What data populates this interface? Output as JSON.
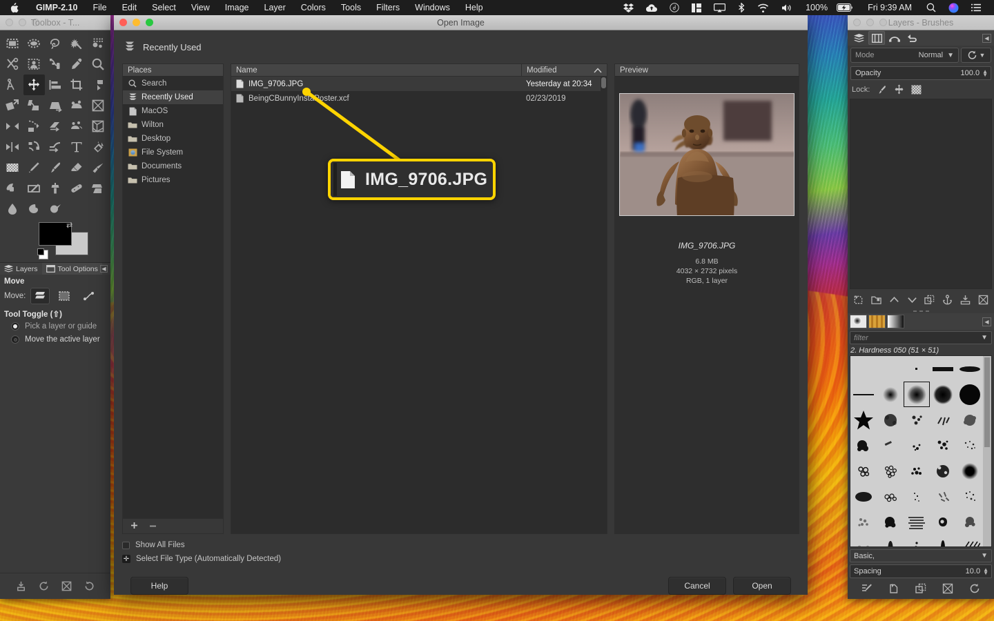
{
  "menubar": {
    "apple_icon": "apple-icon",
    "app_name": "GIMP-2.10",
    "items": [
      "File",
      "Edit",
      "Select",
      "View",
      "Image",
      "Layer",
      "Colors",
      "Tools",
      "Filters",
      "Windows",
      "Help"
    ],
    "status_icons": [
      "dropbox-icon",
      "cloud-upload-icon",
      "d-circle-icon",
      "grid-panel-icon",
      "airplay-icon",
      "bluetooth-icon",
      "wifi-icon",
      "volume-icon"
    ],
    "battery_percent": "100%",
    "battery_icon": "battery-charging-icon",
    "clock": "Fri 9:39 AM",
    "search_icon": "search-icon",
    "siri_icon": "siri-icon",
    "control_center_icon": "list-icon"
  },
  "toolbox": {
    "title": "Toolbox - T...",
    "tools": [
      "rect-select-tool",
      "ellipse-select-tool",
      "free-select-tool",
      "fuzzy-select-tool",
      "select-by-color-tool",
      "scissors-select-tool",
      "foreground-select-tool",
      "paths-tool",
      "color-picker-tool",
      "zoom-tool",
      "measure-tool",
      "move-tool",
      "alignment-tool",
      "crop-tool",
      "rotate-tool",
      "scale-tool",
      "shear-tool",
      "perspective-tool",
      "unified-transform-tool",
      "3d-transform-tool",
      "flip-tool",
      "cage-transform-tool",
      "warp-transform-tool",
      "text-tool",
      "bucket-fill-tool",
      "gradient-tool",
      "pencil-tool",
      "paintbrush-tool",
      "eraser-tool",
      "airbrush-tool",
      "ink-tool",
      "mypaint-brush-tool",
      "clone-tool",
      "heal-tool",
      "perspective-clone-tool",
      "blur-sharpen-tool",
      "smudge-tool",
      "dodge-burn-tool"
    ],
    "active_tool": "move-tool",
    "foreground_color": "#000000",
    "background_color": "#c9c9c9",
    "dock_tabs": [
      {
        "label": "Layers",
        "icon": "layers-icon",
        "selected": false
      },
      {
        "label": "Tool Options",
        "icon": "tool-options-icon",
        "selected": true
      }
    ],
    "collapse_icon": "collapse-icon",
    "tool_options": {
      "title": "Move",
      "move_label": "Move:",
      "move_modes": [
        "move-layer-icon",
        "move-selection-icon",
        "move-path-icon"
      ],
      "move_mode_active": 0,
      "tool_toggle_label": "Tool Toggle",
      "tool_toggle_shortcut": "(⇧)",
      "options": [
        {
          "label": "Pick a layer or guide",
          "selected": true
        },
        {
          "label": "Move the active layer",
          "selected": false
        }
      ]
    },
    "footer_icons": [
      "save-tool-preset-icon",
      "restore-tool-preset-icon",
      "delete-tool-preset-icon",
      "reset-tool-options-icon"
    ]
  },
  "dialog": {
    "title": "Open Image",
    "location_icon": "recently-used-icon",
    "location_label": "Recently Used",
    "places_header": "Places",
    "places": [
      {
        "label": "Search",
        "icon": "search-icon",
        "selected": false
      },
      {
        "label": "Recently Used",
        "icon": "recently-used-icon",
        "selected": true
      },
      {
        "label": "MacOS",
        "icon": "drive-icon",
        "selected": false
      },
      {
        "label": "Wilton",
        "icon": "folder-icon",
        "selected": false
      },
      {
        "label": "Desktop",
        "icon": "folder-icon",
        "selected": false
      },
      {
        "label": "File System",
        "icon": "filesystem-icon",
        "selected": false
      },
      {
        "label": "Documents",
        "icon": "folder-icon",
        "selected": false
      },
      {
        "label": "Pictures",
        "icon": "folder-icon",
        "selected": false
      }
    ],
    "places_footer": {
      "add_icon": "add-bookmark-icon",
      "remove_icon": "remove-bookmark-icon"
    },
    "columns": {
      "name": "Name",
      "modified": "Modified",
      "sort_icon": "sort-ascending-icon"
    },
    "files": [
      {
        "name": "IMG_9706.JPG",
        "modified": "Yesterday at 20:34",
        "icon": "file-icon",
        "selected": true
      },
      {
        "name": "BeingCBunnyInstaPoster.xcf",
        "modified": "02/23/2019",
        "icon": "file-icon",
        "selected": false
      }
    ],
    "preview": {
      "header": "Preview",
      "image_alt": "fearless-girl-statue-photo",
      "name": "IMG_9706.JPG",
      "size": "6.8 MB",
      "dimensions": "4032 × 2732 pixels",
      "mode": "RGB, 1 layer"
    },
    "show_all_files": {
      "label": "Show All Files",
      "checked": false
    },
    "file_type": {
      "label": "Select File Type (Automatically Detected)",
      "expanded": false
    },
    "buttons": {
      "help": "Help",
      "cancel": "Cancel",
      "open": "Open"
    }
  },
  "callout": {
    "file_icon": "file-icon",
    "text": "IMG_9706.JPG",
    "border_color": "#ffd400"
  },
  "right_dock": {
    "title": "Layers - Brushes",
    "tabs": [
      {
        "icon": "layers-icon",
        "selected": false
      },
      {
        "icon": "channels-icon",
        "selected": true
      },
      {
        "icon": "paths-icon",
        "selected": false
      },
      {
        "icon": "undo-history-icon",
        "selected": false
      }
    ],
    "collapse_icon": "collapse-icon",
    "mode": {
      "label": "Mode",
      "value": "Normal",
      "chevron": "chevron-down-icon"
    },
    "revert_icon": "revert-blend-icon",
    "opacity": {
      "label": "Opacity",
      "value": "100.0"
    },
    "lock": {
      "label": "Lock:",
      "icons": [
        "lock-pixels-icon",
        "lock-position-icon",
        "lock-alpha-icon"
      ]
    },
    "layer_buttons": [
      "new-layer-icon",
      "new-layer-group-icon",
      "raise-layer-icon",
      "lower-layer-icon",
      "duplicate-layer-icon",
      "anchor-layer-icon",
      "merge-down-icon",
      "delete-layer-icon"
    ],
    "brush_tabs": [
      {
        "icon": "brushes-icon",
        "selected": true
      },
      {
        "icon": "patterns-icon",
        "selected": false
      },
      {
        "icon": "gradients-icon",
        "selected": false
      }
    ],
    "brush_collapse_icon": "collapse-icon",
    "filter": {
      "placeholder": "filter",
      "chevron": "chevron-down-icon"
    },
    "selected_brush": "2. Hardness 050 (51 × 51)",
    "brush_set": {
      "label": "Basic,",
      "chevron": "chevron-down-icon"
    },
    "spacing": {
      "label": "Spacing",
      "value": "10.0"
    },
    "brush_footer_icons": [
      "edit-brush-icon",
      "new-brush-icon",
      "duplicate-brush-icon",
      "delete-brush-icon",
      "refresh-brushes-icon"
    ]
  }
}
